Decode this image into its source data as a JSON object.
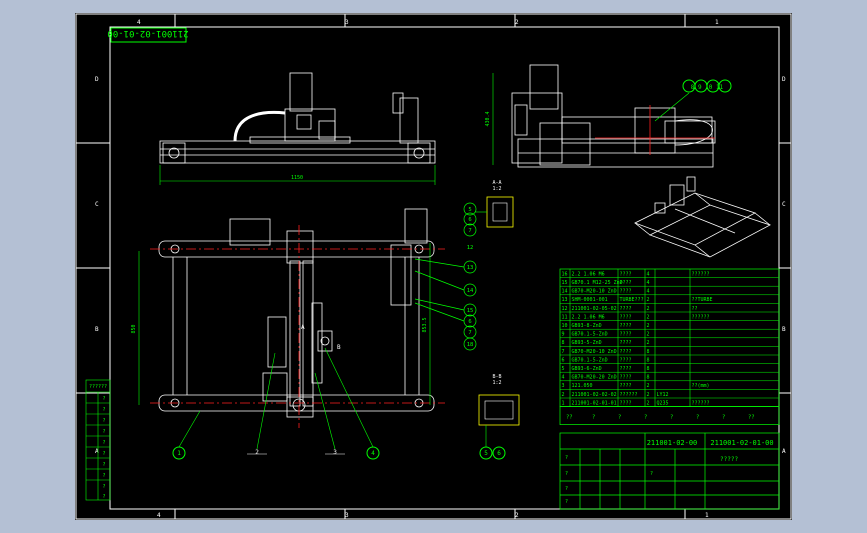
{
  "drawing_number": "211001-02-01-00",
  "border_letters_left": [
    "D",
    "C",
    "B",
    "A"
  ],
  "border_letters_right": [
    "D",
    "C",
    "B",
    "A"
  ],
  "border_numbers_top": [
    "4",
    "3",
    "2",
    "1"
  ],
  "border_numbers_bottom": [
    "4",
    "3",
    "2",
    "1"
  ],
  "front_view": {
    "width_dim": "1150",
    "height_dim": "850",
    "height_dim_right": "853.5",
    "balloons": [
      "1",
      "2",
      "3",
      "4"
    ],
    "side_balloons": [
      "5",
      "6",
      "7",
      "12",
      "13",
      "14",
      "15",
      "6",
      "7",
      "18"
    ],
    "marker_a": "A",
    "marker_b": "B"
  },
  "side_view": {
    "height_dim": "430.4",
    "balloon_group": "8 9 10 11"
  },
  "section_a": {
    "title": "A-A",
    "scale": "1:2"
  },
  "section_b": {
    "title": "B-B",
    "scale": "1:2",
    "balloons": [
      "5",
      "6"
    ]
  },
  "bom": {
    "rows": [
      {
        "no": "16",
        "code": "2.2 1.06 M6",
        "name": "????",
        "qty": "4",
        "mat": "",
        "note": "??????"
      },
      {
        "no": "15",
        "code": "GB70.1 M12-25 ZnD",
        "name": "????",
        "qty": "4",
        "mat": "",
        "note": ""
      },
      {
        "no": "14",
        "code": "GB70-M20-10 ZnD",
        "name": "????",
        "qty": "4",
        "mat": "",
        "note": ""
      },
      {
        "no": "13",
        "code": "SHM-0001-001",
        "name": "TURBE???",
        "qty": "2",
        "mat": "",
        "note": "??TURBE"
      },
      {
        "no": "12",
        "code": "211001-02-05-02",
        "name": "????",
        "qty": "2",
        "mat": "",
        "note": "??"
      },
      {
        "no": "11",
        "code": "2.2 1.06 M6",
        "name": "????",
        "qty": "2",
        "mat": "",
        "note": "??????"
      },
      {
        "no": "10",
        "code": "GB93-8-ZnD",
        "name": "????",
        "qty": "2",
        "mat": "",
        "note": ""
      },
      {
        "no": "9",
        "code": "GB70.1-5-ZnD",
        "name": "????",
        "qty": "2",
        "mat": "",
        "note": ""
      },
      {
        "no": "8",
        "code": "GB93-5-ZnD",
        "name": "????",
        "qty": "2",
        "mat": "",
        "note": ""
      },
      {
        "no": "7",
        "code": "GB70-M20-10 ZnD",
        "name": "????",
        "qty": "8",
        "mat": "",
        "note": ""
      },
      {
        "no": "6",
        "code": "GB70.1-5-ZnD",
        "name": "????",
        "qty": "8",
        "mat": "",
        "note": ""
      },
      {
        "no": "5",
        "code": "GB93-6-ZnD",
        "name": "????",
        "qty": "8",
        "mat": "",
        "note": ""
      },
      {
        "no": "4",
        "code": "GB70-M20-20 ZnD",
        "name": "????",
        "qty": "8",
        "mat": "",
        "note": ""
      },
      {
        "no": "3",
        "code": "121.050",
        "name": "????",
        "qty": "2",
        "mat": "",
        "note": "??(mm)"
      },
      {
        "no": "2",
        "code": "211001-02-02-02",
        "name": "??????",
        "qty": "2",
        "mat": "LY12",
        "note": ""
      },
      {
        "no": "1",
        "code": "211001-02-01-01",
        "name": "????",
        "qty": "2",
        "mat": "Q235",
        "note": "??????"
      }
    ],
    "header_marks": [
      "??",
      "?",
      "?",
      "?",
      "?",
      "?",
      "?",
      "??"
    ]
  },
  "title_block": {
    "assembly_code": "211001-02-00",
    "part_code": "211001-02-01-00",
    "name": "?????",
    "row_labels": [
      "?",
      "?",
      "?",
      "?",
      "?"
    ]
  },
  "left_strip": {
    "header": "??????",
    "cells": [
      "?",
      "?",
      "?",
      "?",
      "?",
      "?",
      "?",
      "?",
      "?",
      "?"
    ]
  },
  "colors": {
    "border": "#ffffff",
    "lines": "#ffffff",
    "center": "#ff2020",
    "dim": "#00ff00",
    "cyan": "#00ffff",
    "yellow": "#ffff00",
    "table": "#00ff00"
  }
}
